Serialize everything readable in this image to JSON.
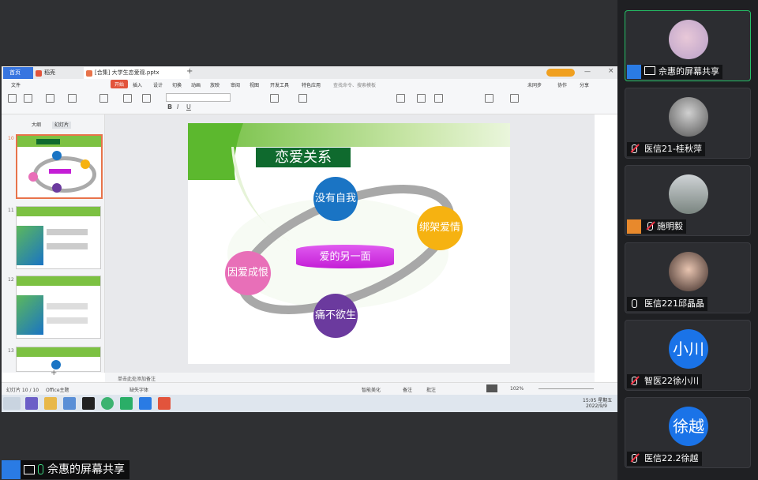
{
  "window_tabs": {
    "home": "首页",
    "workspace": "稻壳",
    "doc": "[合集] 大学生恋爱观.pptx"
  },
  "menu": [
    "文件",
    "开始",
    "插入",
    "设计",
    "切换",
    "动画",
    "放映",
    "审阅",
    "视图",
    "开发工具",
    "特色应用",
    "查找命令、搜索模板"
  ],
  "menu_right": [
    "未同步",
    "协作",
    "分享"
  ],
  "sidebar": {
    "tabs": [
      "大纲",
      "幻灯片"
    ],
    "slide_numbers": [
      "10",
      "11",
      "12",
      "13"
    ]
  },
  "slide": {
    "title": "恋爱关系",
    "center": "爱的另一面",
    "nodes": {
      "top": "没有自我",
      "right": "绑架爱情",
      "bottom": "痛不欲生",
      "left": "因爱成恨"
    }
  },
  "notes_placeholder": "单击此处添加备注",
  "status": {
    "slide_info": "幻灯片 10 / 10",
    "theme": "Office主题",
    "font": "缺失字体",
    "smart": "智能美化",
    "notes": "备注",
    "comments": "批注",
    "zoom": "102%"
  },
  "clock": {
    "time": "15:05 星期五",
    "date": "2022/9/9"
  },
  "participants": [
    {
      "name": "佘惠的屏幕共享",
      "active": true,
      "host": true,
      "mic": "on"
    },
    {
      "name": "医信21-桂秋萍",
      "mic": "off"
    },
    {
      "name": "施明毅",
      "host": true,
      "mic": "off"
    },
    {
      "name": "医信221邱晶晶",
      "mic": "on"
    },
    {
      "name": "智医22徐小川",
      "avatar_text": "小川",
      "mic": "off"
    },
    {
      "name": "医信22.2徐越",
      "avatar_text": "徐越",
      "mic": "off"
    }
  ],
  "bottom_label": "佘惠的屏幕共享",
  "colors": {
    "accent": "#25c067",
    "wps_red": "#e2543c",
    "node_top": "#1a74c4",
    "node_right": "#f6b211",
    "node_bottom": "#6b3a9e",
    "node_left": "#e86fb8",
    "center": "#c41ed6",
    "title_bg": "#0f6a2e"
  }
}
